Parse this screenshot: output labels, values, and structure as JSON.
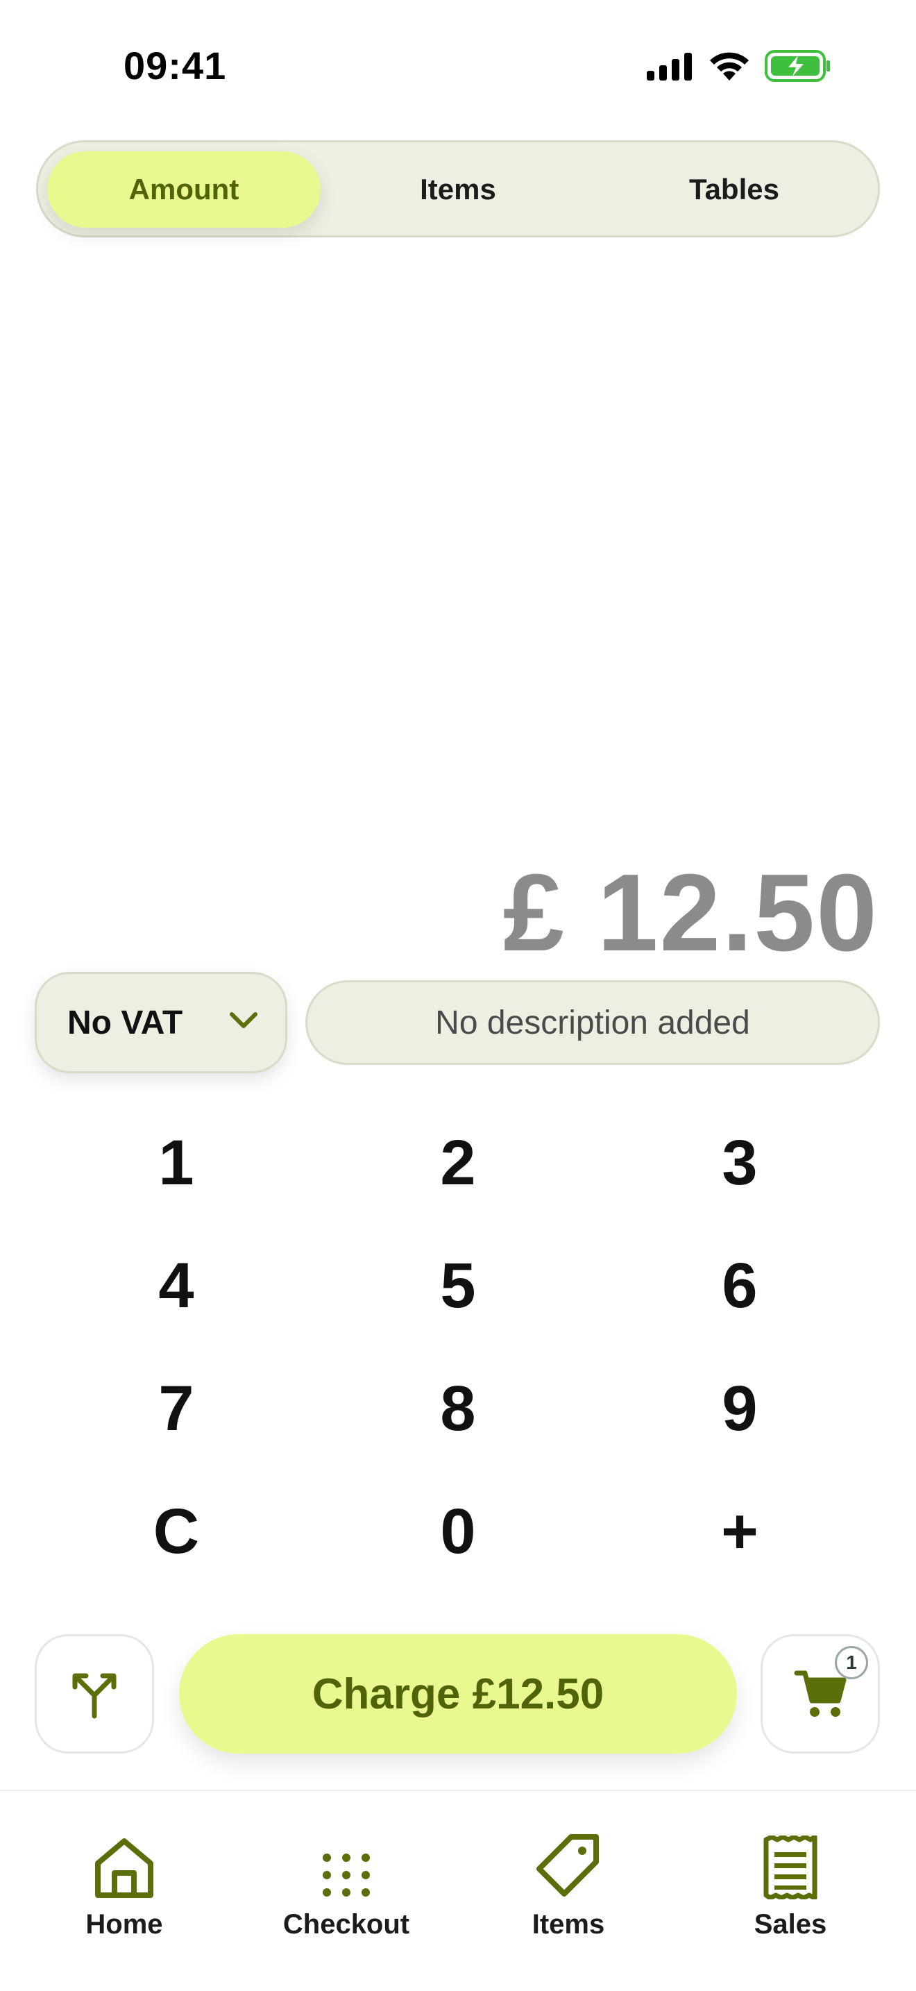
{
  "status_bar": {
    "time": "09:41"
  },
  "segments": [
    {
      "label": "Amount",
      "active": true
    },
    {
      "label": "Items",
      "active": false
    },
    {
      "label": "Tables",
      "active": false
    }
  ],
  "amount": {
    "display": "£ 12.50"
  },
  "vat": {
    "label": "No VAT"
  },
  "description": {
    "placeholder": "No description added"
  },
  "keypad": [
    "1",
    "2",
    "3",
    "4",
    "5",
    "6",
    "7",
    "8",
    "9",
    "C",
    "0",
    "+"
  ],
  "actions": {
    "split_icon": "split-icon",
    "charge_label": "Charge £12.50",
    "cart_icon": "cart-icon",
    "cart_count": "1"
  },
  "tabbar": [
    {
      "label": "Home",
      "icon": "home-icon"
    },
    {
      "label": "Checkout",
      "icon": "keypad-dots-icon"
    },
    {
      "label": "Items",
      "icon": "tag-icon"
    },
    {
      "label": "Sales",
      "icon": "receipt-icon"
    }
  ],
  "colors": {
    "accent": "#eaf98f",
    "accent_text": "#4f6408",
    "surface": "#eeefe2",
    "icon": "#5a6e0a",
    "battery": "#3ec03e"
  }
}
